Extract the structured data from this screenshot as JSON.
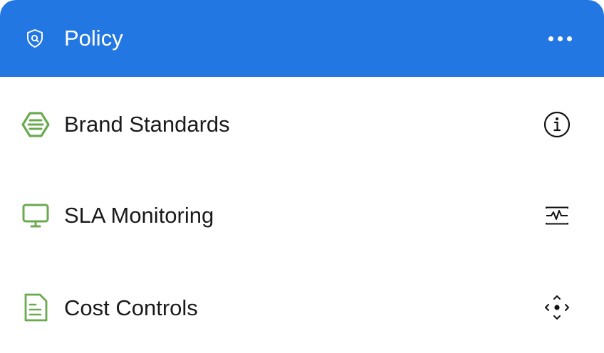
{
  "header": {
    "title": "Policy",
    "icon": "shield-search-icon",
    "menu_icon": "more-horizontal-icon"
  },
  "items": [
    {
      "label": "Brand Standards",
      "icon": "stack-badge-icon",
      "action_icon": "info-icon"
    },
    {
      "label": "SLA Monitoring",
      "icon": "monitor-icon",
      "action_icon": "activity-pulse-icon"
    },
    {
      "label": "Cost Controls",
      "icon": "document-lines-icon",
      "action_icon": "move-arrows-icon"
    }
  ],
  "colors": {
    "header_bg": "#2277e3",
    "accent_green": "#6aaa4f",
    "text": "#1a1a1a"
  }
}
